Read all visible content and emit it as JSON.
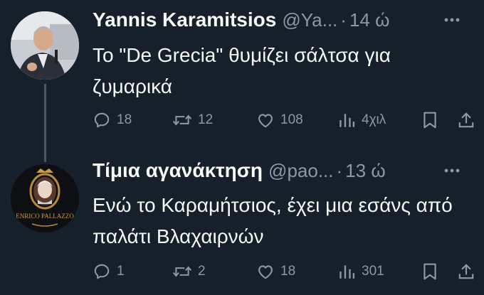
{
  "tweets": [
    {
      "display_name": "Yannis Karamitsios",
      "handle": "@Ya...",
      "separator": "·",
      "time": "14 ώ",
      "text": "Το \"De Grecia\" θυμίζει σάλτσα για ζυμαρικά",
      "stats": {
        "replies": "18",
        "retweets": "12",
        "likes": "108",
        "views": "4χιλ"
      }
    },
    {
      "display_name": "Τίμια αγανάκτηση",
      "handle": "@pao...",
      "separator": "·",
      "time": "13 ώ",
      "text": "Ενώ το Καραμήτσιος, έχει μια εσάνς από παλάτι Βλαχαιρνών",
      "avatar_text": "ENRICO PALLAZZO",
      "stats": {
        "replies": "1",
        "retweets": "2",
        "likes": "18",
        "views": "301"
      }
    }
  ],
  "colors": {
    "background": "#15202b",
    "primary_text": "#f7f9f9",
    "secondary_text": "#8b98a5",
    "thread_line": "#4a5763"
  },
  "icons": [
    "reply-icon",
    "retweet-icon",
    "like-icon",
    "views-icon",
    "bookmark-icon",
    "share-icon",
    "more-icon"
  ]
}
